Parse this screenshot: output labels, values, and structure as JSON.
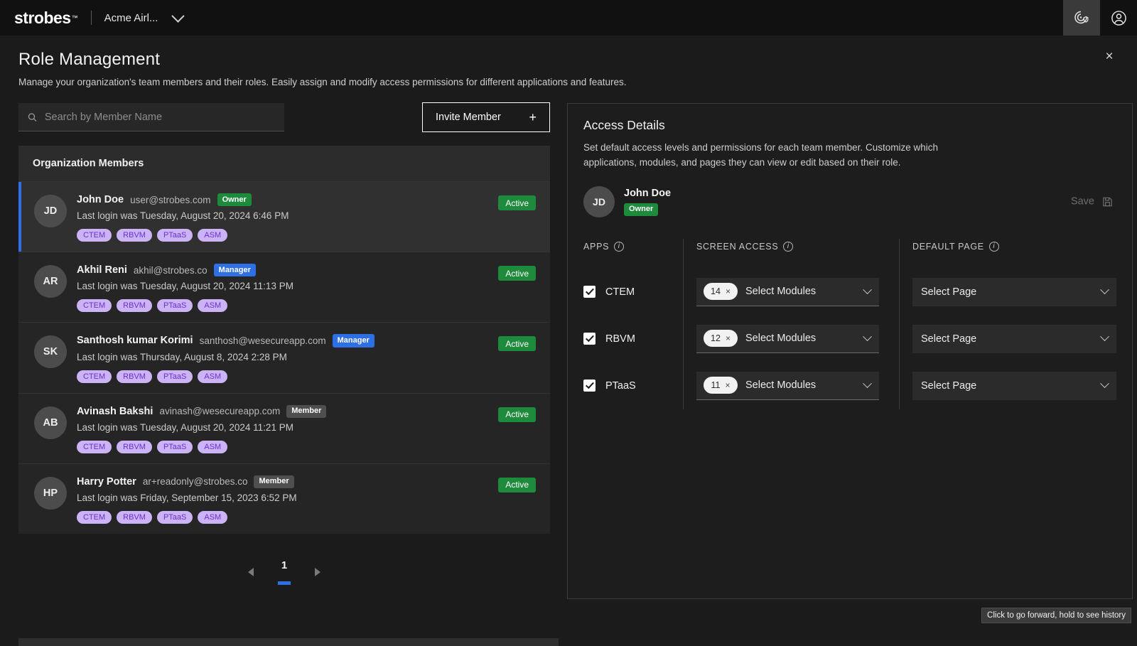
{
  "topbar": {
    "logo": "strobes",
    "trademark": "™",
    "org": "Acme Airl...",
    "icons": {
      "scan": "radar-shield-icon",
      "account": "account-circle-icon"
    }
  },
  "header": {
    "title": "Role Management",
    "subtitle": "Manage your organization's team members and their roles. Easily assign and modify access permissions for different applications and features.",
    "close": "×"
  },
  "search": {
    "placeholder": "Search by Member Name",
    "value": ""
  },
  "invite": {
    "label": "Invite Member",
    "plus": "+"
  },
  "members_panel": {
    "heading": "Organization Members",
    "rows": [
      {
        "initials": "JD",
        "name": "John Doe",
        "email": "user@strobes.com",
        "role": "Owner",
        "role_kind": "owner",
        "login": "Last login was Tuesday, August 20, 2024 6:46 PM",
        "tags": [
          "CTEM",
          "RBVM",
          "PTaaS",
          "ASM"
        ],
        "status": "Active",
        "selected": true
      },
      {
        "initials": "AR",
        "name": "Akhil Reni",
        "email": "akhil@strobes.co",
        "role": "Manager",
        "role_kind": "manager",
        "login": "Last login was Tuesday, August 20, 2024 11:13 PM",
        "tags": [
          "CTEM",
          "RBVM",
          "PTaaS",
          "ASM"
        ],
        "status": "Active",
        "selected": false
      },
      {
        "initials": "SK",
        "name": "Santhosh kumar Korimi",
        "email": "santhosh@wesecureapp.com",
        "role": "Manager",
        "role_kind": "manager",
        "login": "Last login was Thursday, August 8, 2024 2:28 PM",
        "tags": [
          "CTEM",
          "RBVM",
          "PTaaS",
          "ASM"
        ],
        "status": "Active",
        "selected": false
      },
      {
        "initials": "AB",
        "name": "Avinash Bakshi",
        "email": "avinash@wesecureapp.com",
        "role": "Member",
        "role_kind": "member",
        "login": "Last login was Tuesday, August 20, 2024 11:21 PM",
        "tags": [
          "CTEM",
          "RBVM",
          "PTaaS",
          "ASM"
        ],
        "status": "Active",
        "selected": false
      },
      {
        "initials": "HP",
        "name": "Harry Potter",
        "email": "ar+readonly@strobes.co",
        "role": "Member",
        "role_kind": "member",
        "login": "Last login was Friday, September 15, 2023 6:52 PM",
        "tags": [
          "CTEM",
          "RBVM",
          "PTaaS",
          "ASM"
        ],
        "status": "Active",
        "selected": false
      }
    ]
  },
  "pagination": {
    "prev": "prev-page-arrow",
    "current": "1",
    "next": "next-page-arrow"
  },
  "access": {
    "title": "Access Details",
    "subtitle": "Set default access levels and permissions for each team member. Customize which applications, modules, and pages they can view or edit based on their role.",
    "user": {
      "initials": "JD",
      "name": "John Doe",
      "role": "Owner"
    },
    "save_label": "Save",
    "columns": {
      "apps": "APPS",
      "screen_access": "SCREEN ACCESS",
      "default_page": "DEFAULT PAGE"
    },
    "rows": [
      {
        "app": "CTEM",
        "checked": true,
        "module_count": "14",
        "modules_placeholder": "Select Modules",
        "page_placeholder": "Select Page"
      },
      {
        "app": "RBVM",
        "checked": true,
        "module_count": "12",
        "modules_placeholder": "Select Modules",
        "page_placeholder": "Select Page"
      },
      {
        "app": "PTaaS",
        "checked": true,
        "module_count": "11",
        "modules_placeholder": "Select Modules",
        "page_placeholder": "Select Page"
      }
    ],
    "chip_remove": "×"
  },
  "tooltip": {
    "text": "Click to go forward, hold to see history"
  },
  "colors": {
    "accent_blue": "#2f6fe4",
    "status_green": "#1e8a3c",
    "tag_purple_bg": "#cbb3f5",
    "tag_purple_fg": "#6633cc",
    "panel_bg": "#252525",
    "page_bg": "#1b1b1b"
  }
}
